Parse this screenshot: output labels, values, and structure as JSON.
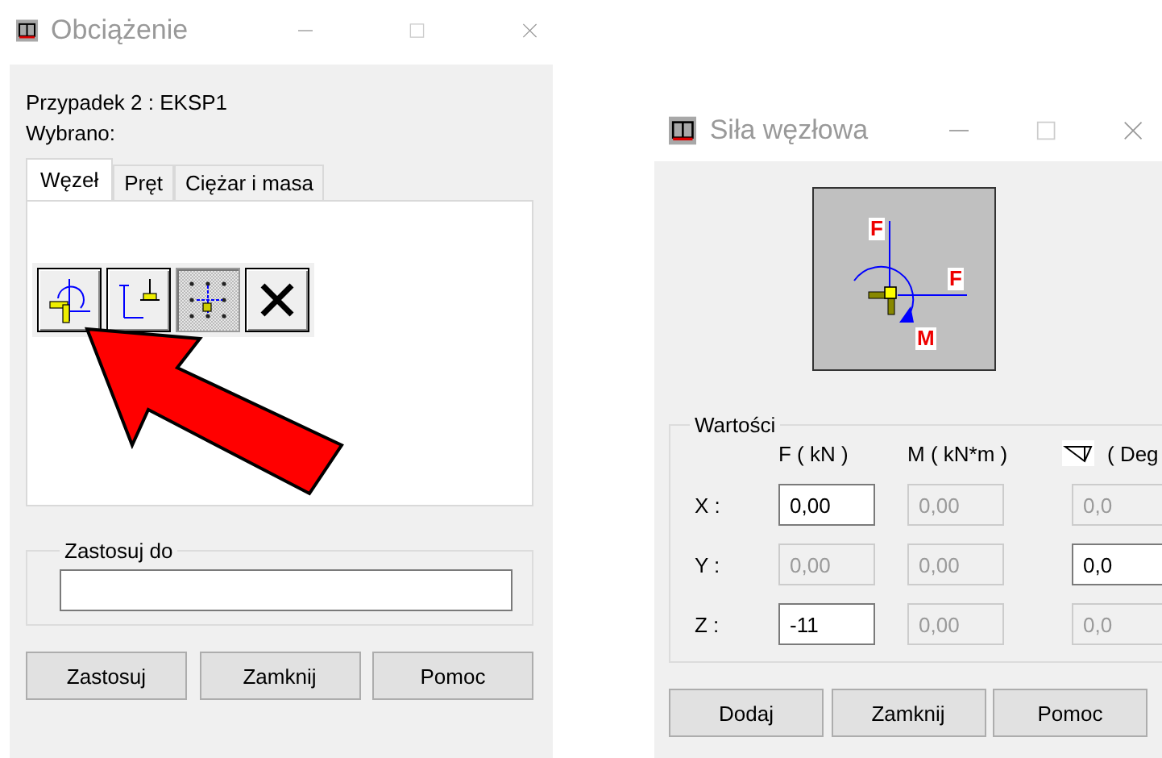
{
  "load_window": {
    "title": "Obciążenie",
    "case_label": "Przypadek 2 : EKSP1",
    "selection_label": "Wybrano:",
    "tabs": [
      {
        "label": "Węzeł",
        "selected": true
      },
      {
        "label": "Pręt",
        "selected": false
      },
      {
        "label": "Ciężar i masa",
        "selected": false
      }
    ],
    "tools": [
      {
        "kind": "nodal-force",
        "selected": false
      },
      {
        "kind": "support-displacement",
        "selected": false
      },
      {
        "kind": "nodal-grid",
        "selected": true
      },
      {
        "kind": "delete",
        "selected": false
      }
    ],
    "apply_to": {
      "label": "Zastosuj do"
    },
    "buttons": [
      "Zastosuj",
      "Zamknij",
      "Pomoc"
    ]
  },
  "force_window": {
    "title": "Siła węzłowa",
    "diagram_labels": [
      "F",
      "F",
      "M"
    ],
    "values": {
      "label": "Wartości",
      "columns": [
        "F ( kN )",
        "M ( kN*m )",
        "( Deg"
      ],
      "rows": [
        {
          "axis": "X :",
          "fields": [
            {
              "value": "0,00",
              "disabled": false
            },
            {
              "value": "0,00",
              "disabled": true
            },
            {
              "value": "0,0",
              "disabled": true
            }
          ]
        },
        {
          "axis": "Y :",
          "fields": [
            {
              "value": "0,00",
              "disabled": true
            },
            {
              "value": "0,00",
              "disabled": true
            },
            {
              "value": "0,0",
              "disabled": false
            }
          ]
        },
        {
          "axis": "Z :",
          "fields": [
            {
              "value": "-11",
              "disabled": false
            },
            {
              "value": "0,00",
              "disabled": true
            },
            {
              "value": "0,0",
              "disabled": true
            }
          ]
        }
      ]
    },
    "buttons": [
      "Dodaj",
      "Zamknij",
      "Pomoc"
    ]
  }
}
